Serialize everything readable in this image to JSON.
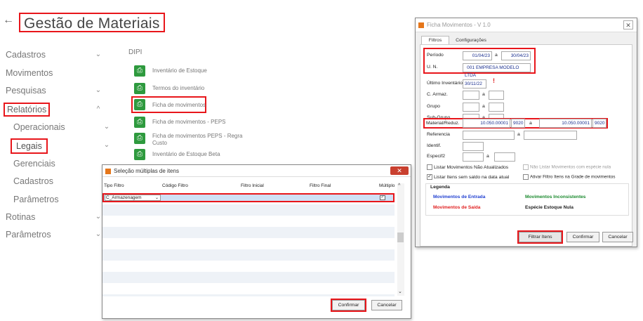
{
  "page": {
    "back_icon": "←",
    "title": "Gestão de Materiais"
  },
  "sidebar": {
    "items": [
      {
        "label": "Cadastros"
      },
      {
        "label": "Movimentos"
      },
      {
        "label": "Pesquisas"
      },
      {
        "label": "Relatórios"
      },
      {
        "label": "Operacionais"
      },
      {
        "label": "Legais"
      },
      {
        "label": "Gerenciais"
      },
      {
        "label": "Cadastros"
      },
      {
        "label": "Parâmetros"
      },
      {
        "label": "Rotinas"
      },
      {
        "label": "Parâmetros"
      }
    ]
  },
  "reports": {
    "heading": "DIPI",
    "items": [
      {
        "label": "Inventário de Estoque"
      },
      {
        "label": "Termos do inventário"
      },
      {
        "label": "Ficha de movimentos"
      },
      {
        "label": "Ficha de movimentos - PEPS"
      },
      {
        "label": "Ficha de movimentos PEPS  - Regra Custo"
      },
      {
        "label": "Inventário de Estoque Beta"
      }
    ]
  },
  "multi_dialog": {
    "title": "Seleção múltiplas de itens",
    "columns": [
      "Tipo Filtro",
      "Código Filtro",
      "Filtro Inicial",
      "Filtro Final",
      "Múltiplo"
    ],
    "row": {
      "tipo": "C_Armazenagem"
    },
    "confirm": "Confirmar",
    "cancel": "Cancelar"
  },
  "ficha": {
    "title": "Ficha Movimentos - V 1.0",
    "tabs": [
      "Filtros",
      "Configurações"
    ],
    "periodo_label": "Período",
    "periodo_from": "01/04/23",
    "periodo_to": "30/04/23",
    "un_label": "U. N.",
    "un_code": "001",
    "un_name": "EMPRESA MODELO LTDA",
    "ultimo_label": "Último Inventário",
    "ultimo_value": "30/11/22",
    "warn": "!",
    "carmaz_label": "C. Armaz.",
    "grupo_label": "Grupo",
    "subgrupo_label": "Sub-Grupo",
    "material_label": "Material/Reduz.",
    "material_from": "10.050.00001",
    "material_from_red": "9020",
    "material_to": "10.050.00001",
    "material_to_red": "9020",
    "referencia_label": "Referencia",
    "identif_label": "Identif.",
    "especif_label": "Especif2",
    "a": "a",
    "chk1": "Listar Movimentos Não Atualizados",
    "chk2": "Não Listar Movimentos com espécie nula",
    "chk3": "Listar Itens sem saldo na data atual",
    "chk4": "Ativar Filtro Itens na Grade de movimentos",
    "legend_title": "Legenda",
    "legend": {
      "entrada": "Movimentos de Entrada",
      "inconsistentes": "Movimentos Inconsistentes",
      "saida": "Movimentos de Saída",
      "nula": "Espécie Estoque Nula"
    },
    "filtrar": "Filtrar Itens",
    "confirm": "Confirmar",
    "cancel": "Cancelar"
  },
  "colors": {
    "accent_red": "#e8161b",
    "entrada": "#1f3fd1",
    "inconsistentes": "#1b8a2e",
    "saida": "#e02020"
  }
}
